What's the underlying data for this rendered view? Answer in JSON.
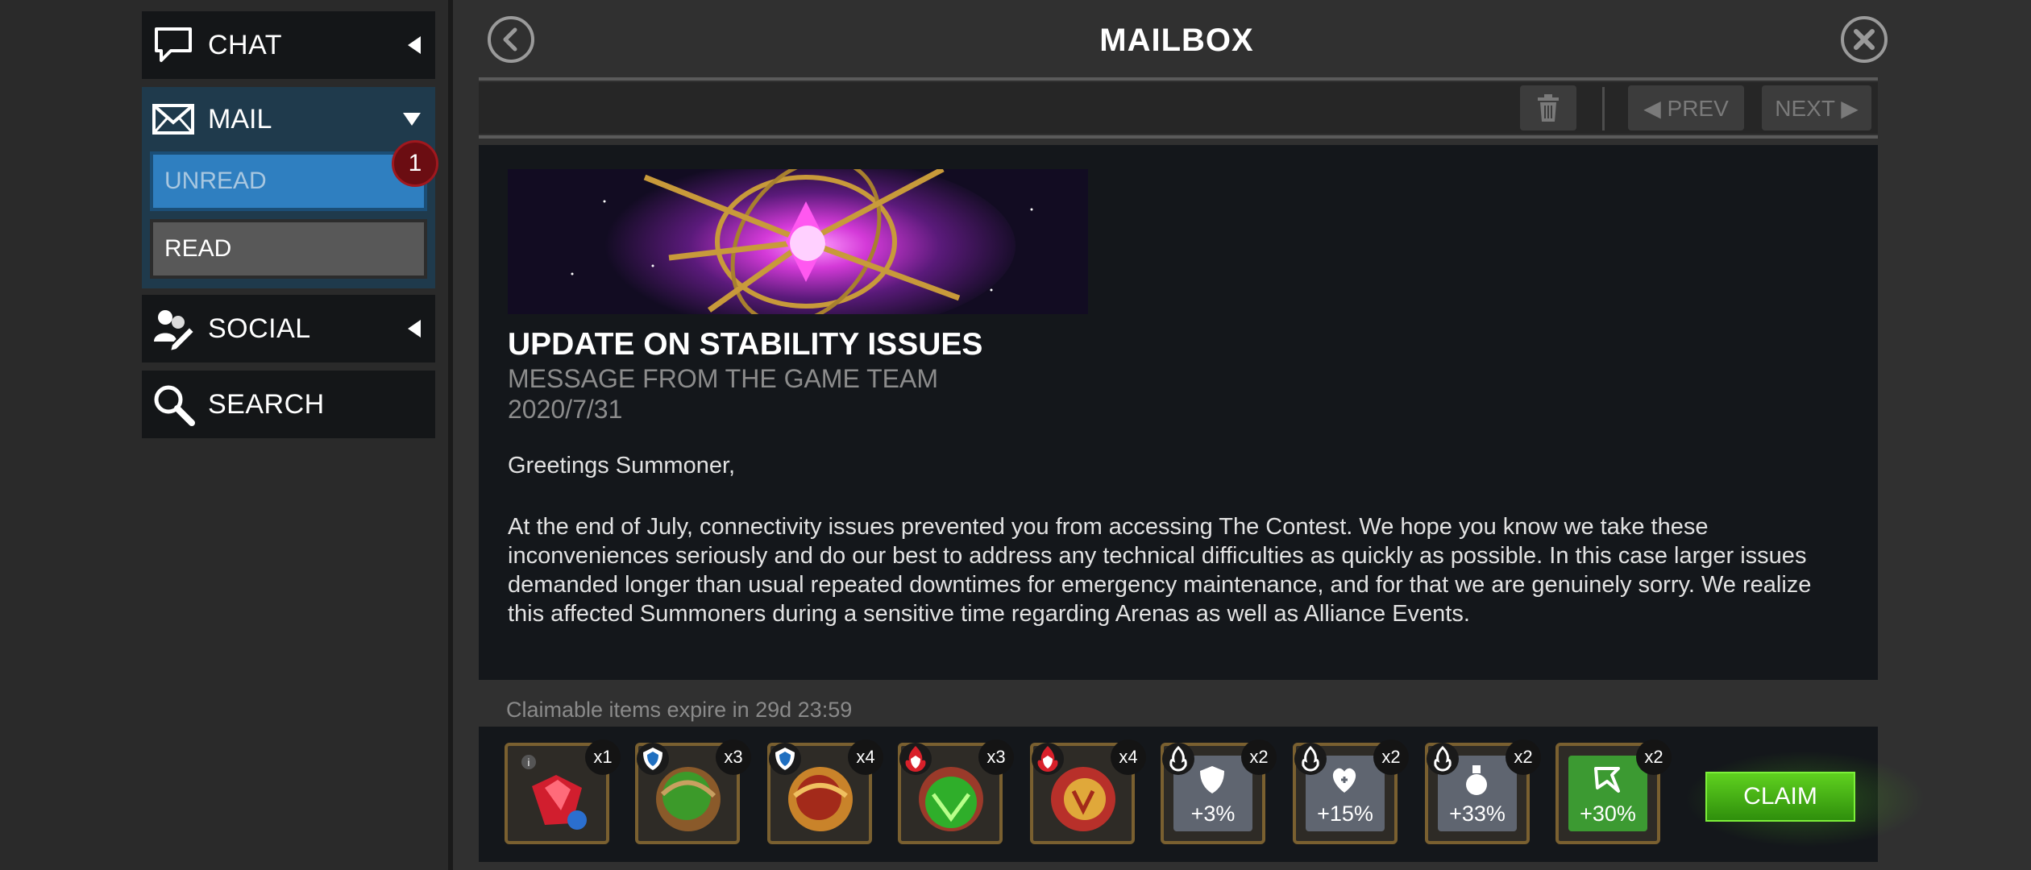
{
  "sidebar": {
    "chat_label": "CHAT",
    "mail_label": "MAIL",
    "unread_label": "UNREAD",
    "unread_badge": "1",
    "read_label": "READ",
    "social_label": "SOCIAL",
    "search_label": "SEARCH"
  },
  "header": {
    "title": "MAILBOX"
  },
  "toolbar": {
    "prev_label": "◀ PREV",
    "next_label": "NEXT ▶"
  },
  "message": {
    "title": "UPDATE ON STABILITY ISSUES",
    "sender": "MESSAGE FROM THE GAME TEAM",
    "date": "2020/7/31",
    "greeting": "Greetings Summoner,",
    "body": "At the end of July, connectivity issues prevented you from accessing The Contest. We hope you know we take these inconveniences seriously and do our best to address any technical difficulties as quickly as possible. In this case larger issues demanded longer than usual repeated downtimes for emergency maintenance, and for that we are genuinely sorry. We realize this affected Summoners during a sensitive time regarding Arenas as well as Alliance Events."
  },
  "rewards": {
    "expire_text": "Claimable items expire in 29d 23:59",
    "items": [
      {
        "name": "crystal-shard",
        "qty": "x1",
        "icon": "red-crystal-icon"
      },
      {
        "name": "green-orb",
        "qty": "x3",
        "icon": "blue-shield-orb-icon"
      },
      {
        "name": "gold-orb",
        "qty": "x4",
        "icon": "blue-shield-orb-icon"
      },
      {
        "name": "green-red-orb",
        "qty": "x3",
        "icon": "red-flame-orb-icon"
      },
      {
        "name": "red-gold-orb",
        "qty": "x4",
        "icon": "red-flame-orb-icon"
      },
      {
        "name": "armor-boost",
        "qty": "x2",
        "boost": "+3%",
        "icon": "shield-icon"
      },
      {
        "name": "health-boost",
        "qty": "x2",
        "boost": "+15%",
        "icon": "health-up-icon"
      },
      {
        "name": "potion-boost",
        "qty": "x2",
        "boost": "+33%",
        "icon": "potion-icon"
      },
      {
        "name": "xp-boost",
        "qty": "x2",
        "boost": "+30%",
        "icon": "arrow-boost-icon"
      }
    ],
    "claim_label": "CLAIM"
  },
  "colors": {
    "accent_blue": "#2f7fc0",
    "badge_red": "#6b0d12",
    "claim_green": "#4bb319",
    "item_border_gold": "#7a6030"
  }
}
